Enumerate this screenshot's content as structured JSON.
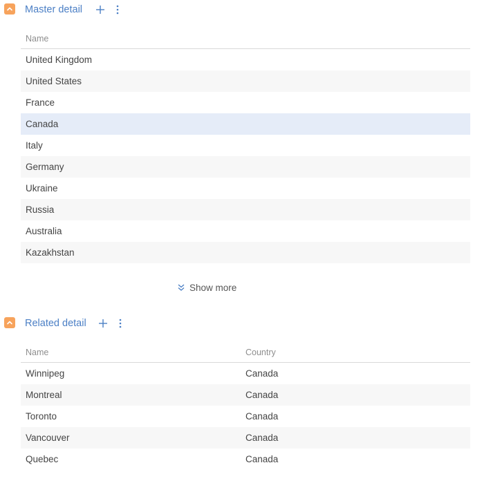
{
  "master": {
    "title": "Master detail",
    "columns": [
      "Name"
    ],
    "rows": [
      "United Kingdom",
      "United States",
      "France",
      "Canada",
      "Italy",
      "Germany",
      "Ukraine",
      "Russia",
      "Australia",
      "Kazakhstan"
    ],
    "selected_index": 3,
    "show_more_label": "Show more"
  },
  "related": {
    "title": "Related detail",
    "columns": [
      "Name",
      "Country"
    ],
    "rows": [
      [
        "Winnipeg",
        "Canada"
      ],
      [
        "Montreal",
        "Canada"
      ],
      [
        "Toronto",
        "Canada"
      ],
      [
        "Vancouver",
        "Canada"
      ],
      [
        "Quebec",
        "Canada"
      ]
    ]
  },
  "colors": {
    "accent_orange": "#f7a35c",
    "link_blue": "#4b7fc5",
    "selected_row": "#e5ecf8",
    "alt_row": "#f7f7f7"
  },
  "icons": {
    "collapse": "chevron-up-icon",
    "add": "plus-icon",
    "menu": "kebab-menu-icon",
    "show_more": "double-chevron-down-icon"
  }
}
